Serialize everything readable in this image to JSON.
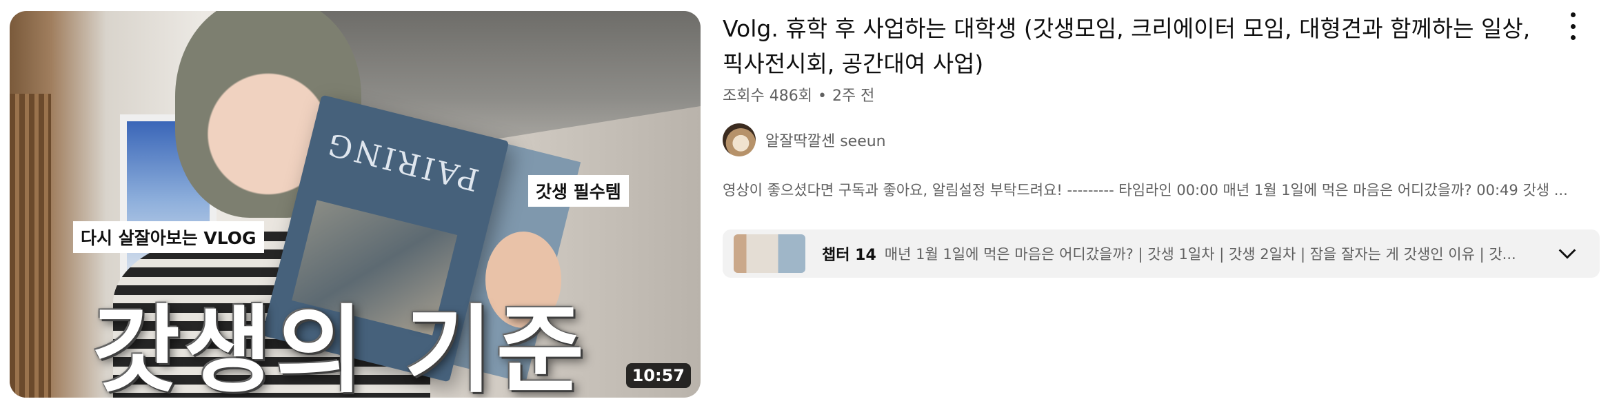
{
  "thumbnail": {
    "overlay_top_right": "갓생 필수템",
    "overlay_left": "다시 살잘아보는 VLOG",
    "big_title": "갓생의 기준",
    "book_title": "PAIRING",
    "duration": "10:57"
  },
  "video": {
    "title": "Volg. 휴학 후 사업하는 대학생 (갓생모임, 크리에이터 모임, 대형견과 함께하는 일상, 픽사전시회, 공간대여 사업)",
    "views": "조회수 486회",
    "separator": "•",
    "age": "2주 전",
    "channel_name": "알잘딱깔센 seeun",
    "description": "영상이 좋으셨다면 구독과 좋아요, 알림설정 부탁드려요! --------- 타임라인 00:00 매년 1월 1일에 먹은 마음은 어디갔을까? 00:49 갓생 ...",
    "chapters_label": "챕터 14",
    "chapters_text": "매년 1월 1일에 먹은 마음은 어디갔을까? | 갓생 1일차 | 갓생 2일차 | 잠을 잘자는 게 갓생인 이유 | 갓..."
  },
  "icons": {
    "menu": "more-vert-icon",
    "expand": "chevron-down-icon"
  },
  "colors": {
    "text_primary": "#0f0f0f",
    "text_secondary": "#606060",
    "chapters_bg": "#f2f2f2"
  }
}
